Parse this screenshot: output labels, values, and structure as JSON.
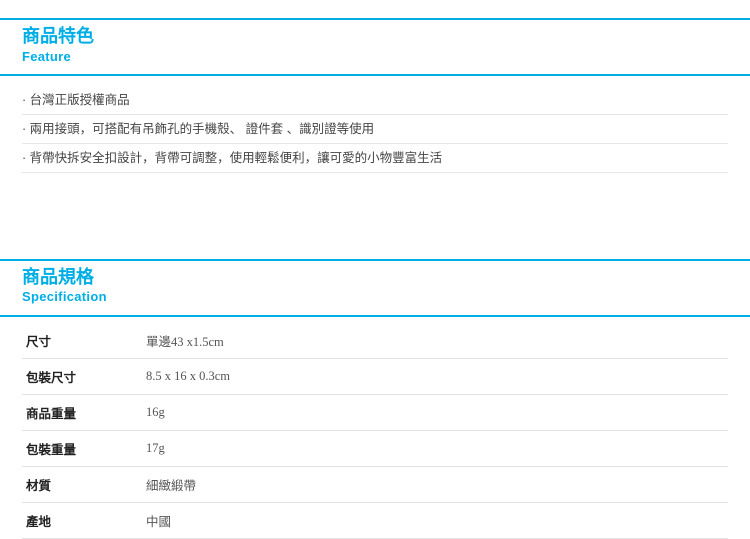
{
  "feature": {
    "title_cn": "商品特色",
    "title_en": "Feature",
    "items": [
      "台灣正版授權商品",
      "兩用接頭，可搭配有吊飾孔的手機殼、 證件套 、識別證等使用",
      "背帶快拆安全扣設計，背帶可調整，使用輕鬆便利，讓可愛的小物豐富生活"
    ]
  },
  "spec": {
    "title_cn": "商品規格",
    "title_en": "Specification",
    "rows": [
      {
        "key": "尺寸",
        "value": "單邊43 x1.5cm"
      },
      {
        "key": "包裝尺寸",
        "value": "8.5 x 16 x 0.3cm"
      },
      {
        "key": "商品重量",
        "value": "16g"
      },
      {
        "key": "包裝重量",
        "value": "17g"
      },
      {
        "key": "材質",
        "value": "細緻緞帶"
      },
      {
        "key": "產地",
        "value": "中國"
      }
    ]
  }
}
